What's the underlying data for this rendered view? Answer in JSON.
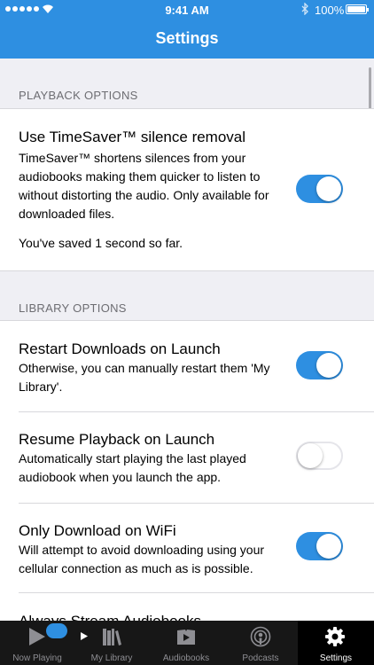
{
  "status_bar": {
    "time": "9:41 AM",
    "battery": "100%"
  },
  "header": {
    "title": "Settings"
  },
  "sections": [
    {
      "title": "PLAYBACK OPTIONS",
      "rows": [
        {
          "title": "Use TimeSaver™ silence removal",
          "description": "TimeSaver™ shortens silences from your audiobooks making them quicker to listen to without distorting the audio.  Only available for downloaded files.",
          "note": "You've saved 1 second so far.",
          "enabled": true
        }
      ]
    },
    {
      "title": "LIBRARY OPTIONS",
      "rows": [
        {
          "title": "Restart Downloads on Launch",
          "description": "Otherwise, you can manually restart them 'My Library'.",
          "enabled": true
        },
        {
          "title": "Resume Playback on Launch",
          "description": "Automatically start playing the last played audiobook when you launch the app.",
          "enabled": false
        },
        {
          "title": "Only Download on WiFi",
          "description": "Will attempt to avoid downloading using your cellular connection as much as is possible.",
          "enabled": true
        },
        {
          "title": "Always Stream Audiobooks"
        }
      ]
    }
  ],
  "tabs": [
    {
      "label": "Now Playing",
      "icon": "play-icon"
    },
    {
      "label": "My Library",
      "icon": "library-icon"
    },
    {
      "label": "Audiobooks",
      "icon": "audiobook-icon"
    },
    {
      "label": "Podcasts",
      "icon": "podcast-icon"
    },
    {
      "label": "Settings",
      "icon": "gear-icon",
      "active": true
    }
  ],
  "colors": {
    "accent": "#2e8fe1",
    "tabbar": "#171717",
    "background": "#efeff4"
  }
}
